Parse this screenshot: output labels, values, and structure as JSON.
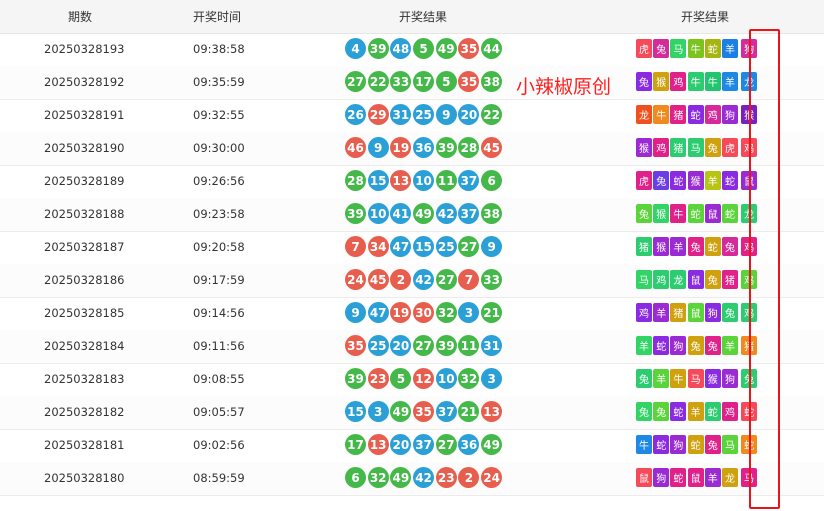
{
  "header": {
    "period": "期数",
    "time": "开奖时间",
    "numbers": "开奖结果",
    "zodiacs": "开奖结果"
  },
  "watermark": "小辣椒原创",
  "colors": {
    "red": "#e85e4e",
    "blue": "#2aa0d7",
    "green": "#45b84a"
  },
  "rows": [
    {
      "period": "20250328193",
      "time": "09:38:58",
      "numbers": [
        "4",
        "39",
        "48",
        "5",
        "49",
        "35",
        "44"
      ],
      "colors": [
        "blue",
        "green",
        "blue",
        "green",
        "green",
        "red",
        "green"
      ],
      "zodiacs": [
        "虎",
        "兔",
        "马",
        "牛",
        "蛇",
        "羊",
        "狗"
      ],
      "zcolors": [
        "#f44a5a",
        "#d42a9a",
        "#33d466",
        "#7bc41f",
        "#a7b513",
        "#1b7fe6",
        "#d22d9b"
      ]
    },
    {
      "period": "20250328192",
      "time": "09:35:59",
      "numbers": [
        "27",
        "22",
        "33",
        "17",
        "5",
        "35",
        "38"
      ],
      "colors": [
        "green",
        "green",
        "green",
        "green",
        "green",
        "red",
        "green"
      ],
      "zodiacs": [
        "兔",
        "猴",
        "鸡",
        "牛",
        "牛",
        "羊",
        "龙"
      ],
      "zcolors": [
        "#8a2be2",
        "#cfa10f",
        "#e0218a",
        "#2ecc71",
        "#22c470",
        "#1e88e5",
        "#1e88e5"
      ]
    },
    {
      "period": "20250328191",
      "time": "09:32:55",
      "numbers": [
        "26",
        "29",
        "31",
        "25",
        "9",
        "20",
        "22"
      ],
      "colors": [
        "blue",
        "red",
        "blue",
        "blue",
        "blue",
        "blue",
        "green"
      ],
      "zodiacs": [
        "龙",
        "牛",
        "猪",
        "蛇",
        "鸡",
        "狗",
        "猴"
      ],
      "zcolors": [
        "#f0501e",
        "#f08a1e",
        "#e0218a",
        "#8a2be2",
        "#d42a9a",
        "#9a2bd2",
        "#7a1fc2"
      ]
    },
    {
      "period": "20250328190",
      "time": "09:30:00",
      "numbers": [
        "46",
        "9",
        "19",
        "36",
        "39",
        "28",
        "45"
      ],
      "colors": [
        "red",
        "blue",
        "red",
        "blue",
        "green",
        "green",
        "red"
      ],
      "zodiacs": [
        "猴",
        "鸡",
        "猪",
        "马",
        "兔",
        "虎",
        "鸡"
      ],
      "zcolors": [
        "#9a2bd2",
        "#e0218a",
        "#2ecc71",
        "#2ecc71",
        "#cfa10f",
        "#f44a5a",
        "#f44a5a"
      ]
    },
    {
      "period": "20250328189",
      "time": "09:26:56",
      "numbers": [
        "28",
        "15",
        "13",
        "10",
        "11",
        "37",
        "6"
      ],
      "colors": [
        "green",
        "blue",
        "red",
        "blue",
        "green",
        "blue",
        "green"
      ],
      "zodiacs": [
        "虎",
        "兔",
        "蛇",
        "猴",
        "羊",
        "蛇",
        "鼠"
      ],
      "zcolors": [
        "#e0218a",
        "#6a3de8",
        "#8a2be2",
        "#9a2bd2",
        "#b7c413",
        "#8a2be2",
        "#9a2bd2"
      ]
    },
    {
      "period": "20250328188",
      "time": "09:23:58",
      "numbers": [
        "39",
        "10",
        "41",
        "49",
        "42",
        "37",
        "38"
      ],
      "colors": [
        "green",
        "blue",
        "blue",
        "green",
        "blue",
        "blue",
        "green"
      ],
      "zodiacs": [
        "兔",
        "猴",
        "牛",
        "蛇",
        "鼠",
        "蛇",
        "龙"
      ],
      "zcolors": [
        "#5ad43a",
        "#33d466",
        "#e0218a",
        "#5ad43a",
        "#9a2bd2",
        "#5ad43a",
        "#2ecc71"
      ]
    },
    {
      "period": "20250328187",
      "time": "09:20:58",
      "numbers": [
        "7",
        "34",
        "47",
        "15",
        "25",
        "27",
        "9"
      ],
      "colors": [
        "red",
        "red",
        "blue",
        "blue",
        "blue",
        "green",
        "blue"
      ],
      "zodiacs": [
        "猪",
        "猴",
        "羊",
        "兔",
        "蛇",
        "兔",
        "鸡"
      ],
      "zcolors": [
        "#2ecc71",
        "#9a2bd2",
        "#9a2bd2",
        "#e0218a",
        "#cfa10f",
        "#d42a9a",
        "#e0218a"
      ]
    },
    {
      "period": "20250328186",
      "time": "09:17:59",
      "numbers": [
        "24",
        "45",
        "2",
        "42",
        "27",
        "7",
        "33"
      ],
      "colors": [
        "red",
        "red",
        "red",
        "blue",
        "green",
        "red",
        "green"
      ],
      "zodiacs": [
        "马",
        "鸡",
        "龙",
        "鼠",
        "兔",
        "猪",
        "鸡"
      ],
      "zcolors": [
        "#33d466",
        "#2ecc71",
        "#2ecc71",
        "#8a2be2",
        "#cfa10f",
        "#e0218a",
        "#5ad43a"
      ]
    },
    {
      "period": "20250328185",
      "time": "09:14:56",
      "numbers": [
        "9",
        "47",
        "19",
        "30",
        "32",
        "3",
        "21"
      ],
      "colors": [
        "blue",
        "blue",
        "red",
        "red",
        "green",
        "blue",
        "green"
      ],
      "zodiacs": [
        "鸡",
        "羊",
        "猪",
        "鼠",
        "狗",
        "兔",
        "鸡"
      ],
      "zcolors": [
        "#8a2be2",
        "#9a2bd2",
        "#cfa10f",
        "#5ad43a",
        "#8a2be2",
        "#2ecc71",
        "#2ecc71"
      ]
    },
    {
      "period": "20250328184",
      "time": "09:11:56",
      "numbers": [
        "35",
        "25",
        "20",
        "27",
        "39",
        "11",
        "31"
      ],
      "colors": [
        "red",
        "blue",
        "blue",
        "green",
        "green",
        "green",
        "blue"
      ],
      "zodiacs": [
        "羊",
        "蛇",
        "狗",
        "兔",
        "兔",
        "羊",
        "猪"
      ],
      "zcolors": [
        "#33d466",
        "#8a2be2",
        "#9a2bd2",
        "#cfa10f",
        "#e0218a",
        "#5ad43a",
        "#f08a1e"
      ]
    },
    {
      "period": "20250328183",
      "time": "09:08:55",
      "numbers": [
        "39",
        "23",
        "5",
        "12",
        "10",
        "32",
        "3"
      ],
      "colors": [
        "green",
        "red",
        "green",
        "red",
        "blue",
        "green",
        "blue"
      ],
      "zodiacs": [
        "兔",
        "羊",
        "牛",
        "马",
        "猴",
        "狗",
        "兔"
      ],
      "zcolors": [
        "#2ecc71",
        "#5ad43a",
        "#cfa10f",
        "#f44a5a",
        "#8a2be2",
        "#9a2bd2",
        "#2ecc71"
      ]
    },
    {
      "period": "20250328182",
      "time": "09:05:57",
      "numbers": [
        "15",
        "3",
        "49",
        "35",
        "37",
        "21",
        "13"
      ],
      "colors": [
        "blue",
        "blue",
        "green",
        "red",
        "blue",
        "green",
        "red"
      ],
      "zodiacs": [
        "兔",
        "兔",
        "蛇",
        "羊",
        "蛇",
        "鸡",
        "蛇"
      ],
      "zcolors": [
        "#33d466",
        "#5ad43a",
        "#8a2be2",
        "#cfa10f",
        "#2ecc71",
        "#e0218a",
        "#f44a5a"
      ]
    },
    {
      "period": "20250328181",
      "time": "09:02:56",
      "numbers": [
        "17",
        "13",
        "20",
        "37",
        "27",
        "36",
        "49"
      ],
      "colors": [
        "green",
        "red",
        "blue",
        "blue",
        "green",
        "blue",
        "green"
      ],
      "zodiacs": [
        "牛",
        "蛇",
        "狗",
        "蛇",
        "兔",
        "马",
        "蛇"
      ],
      "zcolors": [
        "#1e88e5",
        "#8a2be2",
        "#9a2bd2",
        "#cfa10f",
        "#e0218a",
        "#5ad43a",
        "#f08a1e"
      ]
    },
    {
      "period": "20250328180",
      "time": "08:59:59",
      "numbers": [
        "6",
        "32",
        "49",
        "42",
        "23",
        "2",
        "24"
      ],
      "colors": [
        "green",
        "green",
        "green",
        "blue",
        "red",
        "red",
        "red"
      ],
      "zodiacs": [
        "鼠",
        "狗",
        "蛇",
        "鼠",
        "羊",
        "龙",
        "马"
      ],
      "zcolors": [
        "#f44a5a",
        "#9a2bd2",
        "#e0218a",
        "#e0218a",
        "#9a2bd2",
        "#cfa10f",
        "#e0218a"
      ]
    }
  ]
}
